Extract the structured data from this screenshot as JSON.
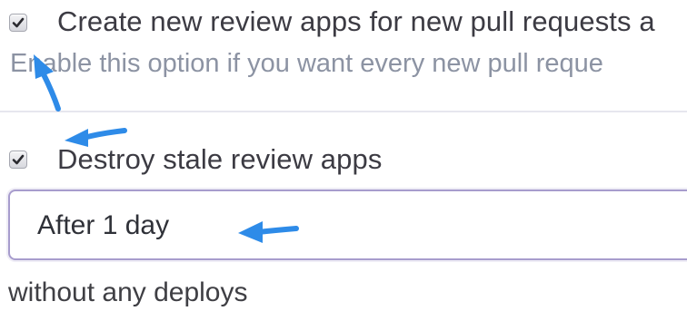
{
  "settings": {
    "create_review_apps": {
      "checked": true,
      "label": "Create new review apps for new pull requests a",
      "helper": "Enable this option if you want every new pull reque"
    },
    "destroy_stale": {
      "checked": true,
      "label": "Destroy stale review apps",
      "select_value": "After 1 day",
      "suffix": "without any deploys"
    }
  },
  "colors": {
    "annotation_arrow": "#2e8be8",
    "select_border": "#a79ccd"
  }
}
